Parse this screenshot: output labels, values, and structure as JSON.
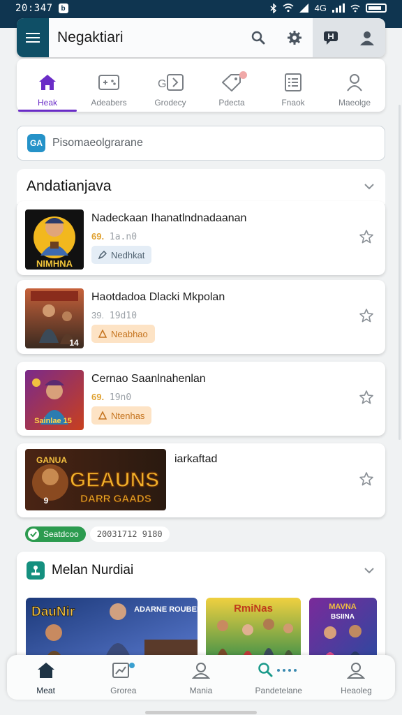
{
  "status_bar": {
    "time": "20:347",
    "right_text": "4G",
    "battery_label": ""
  },
  "app_bar": {
    "title": "Negaktiari"
  },
  "tabs": [
    {
      "label": "Heak",
      "icon": "home-icon",
      "active": true
    },
    {
      "label": "Adeabers",
      "icon": "controller-icon",
      "active": false
    },
    {
      "label": "Grodecy",
      "icon": "cards-icon",
      "active": false
    },
    {
      "label": "Pdecta",
      "icon": "tag-icon",
      "active": false
    },
    {
      "label": "Fnaok",
      "icon": "list-icon",
      "active": false
    },
    {
      "label": "Maeolge",
      "icon": "user-icon",
      "active": false
    }
  ],
  "search": {
    "badge": "GA",
    "placeholder": "Pisomaeolgrarane"
  },
  "section1": {
    "title": "Andatianjava"
  },
  "games": [
    {
      "title": "Nadeckaan Ihanatlndnadaanan",
      "price": "69.",
      "meta": "1a.n0",
      "badge": "Nedhkat",
      "badge_color": "blue",
      "thumb_caption": "NIMHNA"
    },
    {
      "title": "Haotdadoa Dlacki Mkpolan",
      "price": "39.",
      "meta": "19d10",
      "badge": "Neabhao",
      "badge_color": "orange",
      "thumb_caption": "14"
    },
    {
      "title": "Cernao Saanlnahenlan",
      "price": "69.",
      "meta": "19n0",
      "badge": "Ntenhas",
      "badge_color": "orange",
      "thumb_caption": "Sainlae 15"
    },
    {
      "title": "iarkaftad",
      "banner_line1": "GEAUNS",
      "banner_line2": "DARR GAADS",
      "banner_top": "GANUA",
      "banner_badge": "9"
    }
  ],
  "status_pill": {
    "label": "Seatdcoo",
    "date": "20031712 9180"
  },
  "section2": {
    "title": "Melan Nurdiai",
    "shelf": [
      {
        "caption": "DauNir",
        "sub": "ADARNE ROUBER"
      },
      {
        "caption": "RmiNas",
        "sub": ""
      },
      {
        "caption": "MAVNA",
        "sub": "BSIINA"
      }
    ]
  },
  "bottom_nav": [
    {
      "label": "Meat",
      "icon": "home-icon",
      "active": true
    },
    {
      "label": "Grorea",
      "icon": "chart-icon",
      "active": false
    },
    {
      "label": "Mania",
      "icon": "profile-icon",
      "active": false
    },
    {
      "label": "Pandetelane",
      "icon": "search-icon",
      "active": false
    },
    {
      "label": "Heaoleg",
      "icon": "account-icon",
      "active": false
    }
  ],
  "colors": {
    "primary": "#0f3550",
    "accent": "#6a2cc7",
    "teal": "#15907f",
    "success": "#2c9b4f"
  }
}
